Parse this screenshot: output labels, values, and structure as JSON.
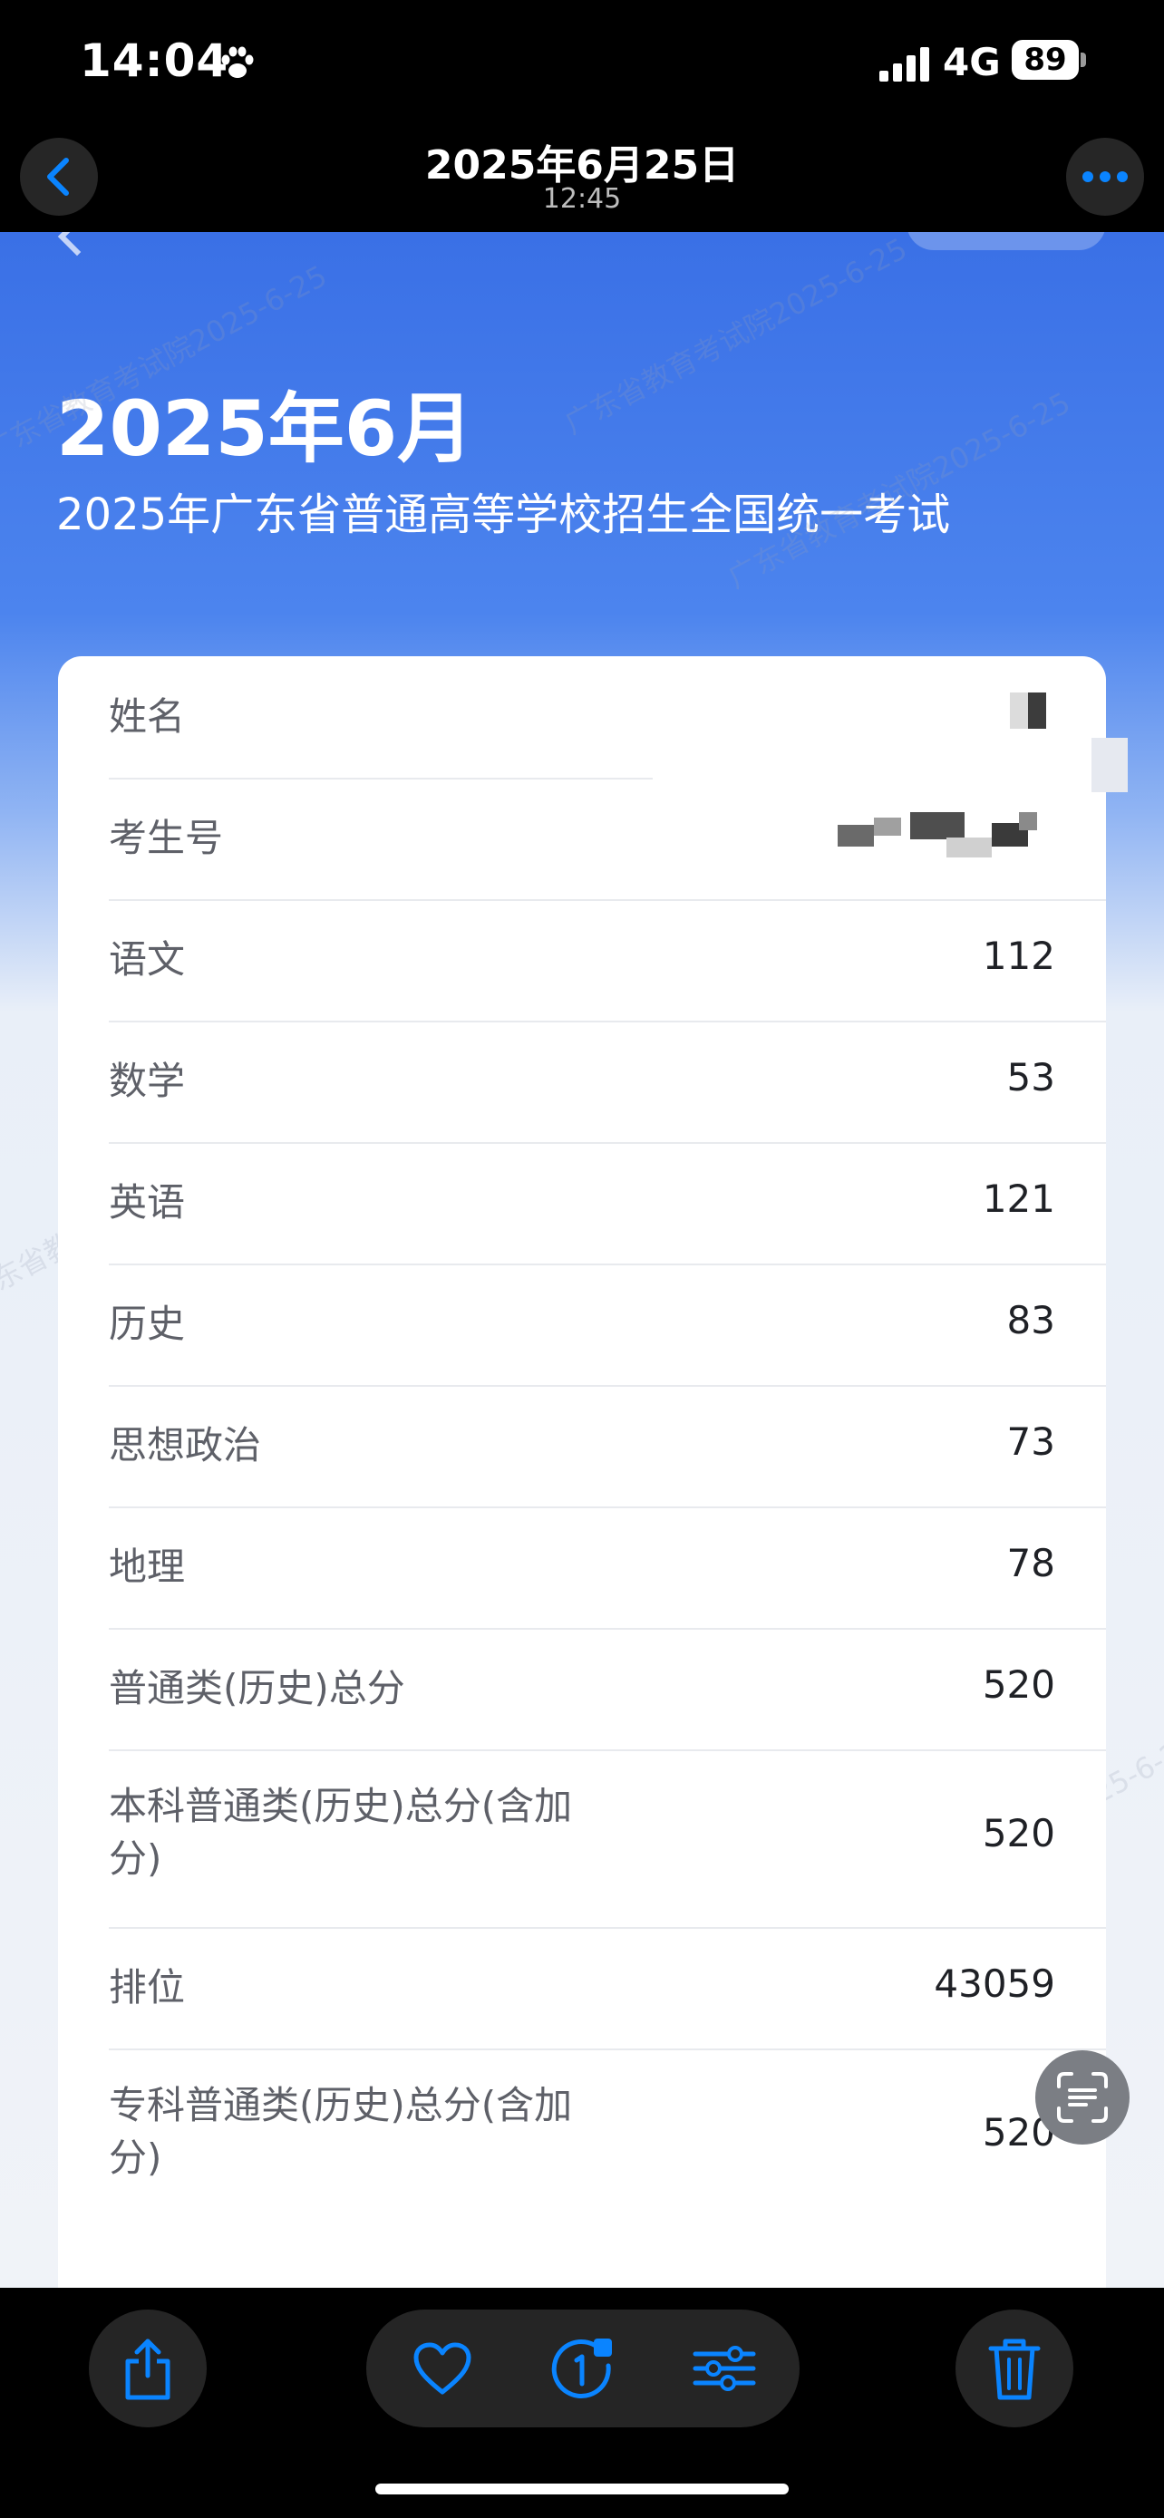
{
  "status_bar": {
    "time": "14:04",
    "network": "4G",
    "battery": "89"
  },
  "nav": {
    "title": "2025年6月25日",
    "subtitle": "12:45"
  },
  "photo": {
    "heading": "2025年6月",
    "subtitle": "2025年广东省普通高等学校招生全国统一考试",
    "watermark": "广东省教育考试院2025-6-25",
    "rows": [
      {
        "label": "姓名",
        "value": ""
      },
      {
        "label": "考生号",
        "value": ""
      },
      {
        "label": "语文",
        "value": "112"
      },
      {
        "label": "数学",
        "value": "53"
      },
      {
        "label": "英语",
        "value": "121"
      },
      {
        "label": "历史",
        "value": "83"
      },
      {
        "label": "思想政治",
        "value": "73"
      },
      {
        "label": "地理",
        "value": "78"
      },
      {
        "label": "普通类(历史)总分",
        "value": "520"
      },
      {
        "label": "本科普通类(历史)总分(含加\n分)",
        "value": "520"
      },
      {
        "label": "排位",
        "value": "43059"
      },
      {
        "label": "专科普通类(历史)总分(含加\n分)",
        "value": "520"
      }
    ]
  },
  "colors": {
    "ios_blue": "#0a84ff",
    "header_blue": "#3a70e6",
    "toolbar_button": "#252525"
  },
  "icons": {
    "back": "chevron-left-icon",
    "more": "ellipsis-icon",
    "share": "share-icon",
    "favorite": "heart-icon",
    "live_text": "info-badge-icon",
    "adjust": "sliders-icon",
    "delete": "trash-icon",
    "scan": "scan-text-icon"
  }
}
